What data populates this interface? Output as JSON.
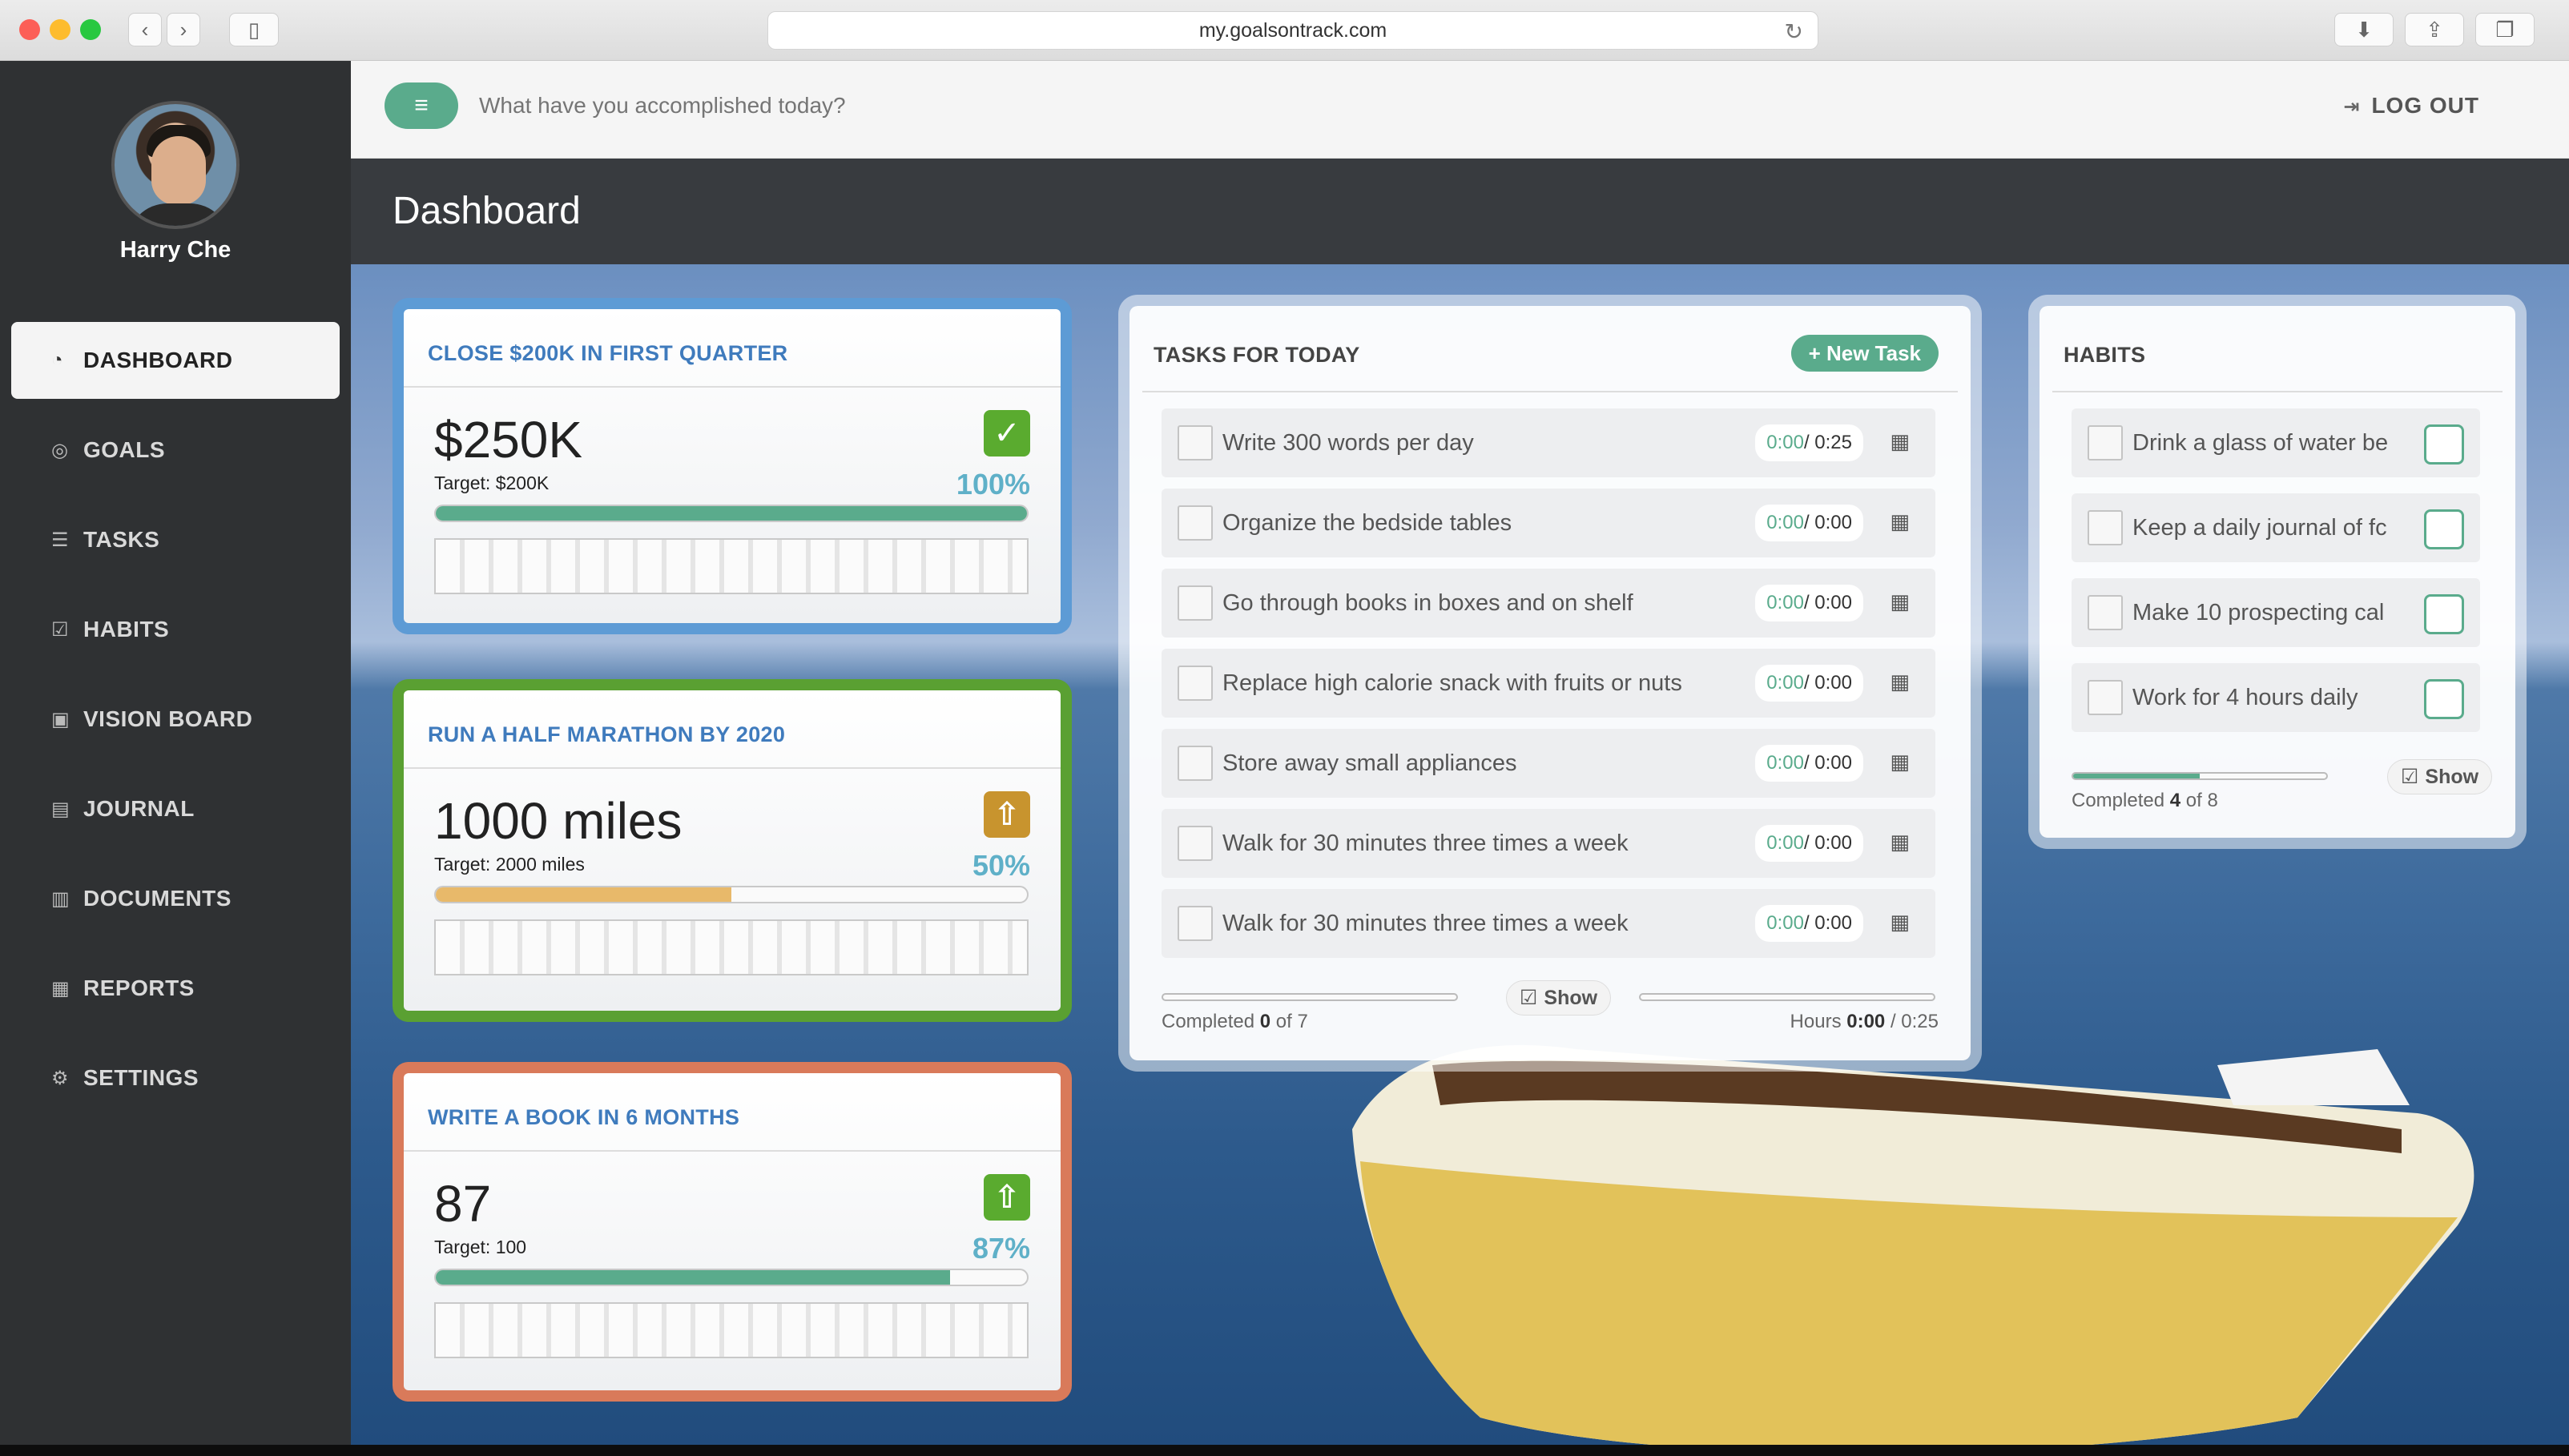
{
  "browser": {
    "url": "my.goalsontrack.com"
  },
  "user": {
    "name": "Harry Che"
  },
  "sidebar": {
    "items": [
      {
        "label": "DASHBOARD",
        "icon": "dashboard-icon",
        "active": true
      },
      {
        "label": "GOALS",
        "icon": "target-icon",
        "active": false
      },
      {
        "label": "TASKS",
        "icon": "list-icon",
        "active": false
      },
      {
        "label": "HABITS",
        "icon": "check-square-icon",
        "active": false
      },
      {
        "label": "VISION BOARD",
        "icon": "picture-icon",
        "active": false
      },
      {
        "label": "JOURNAL",
        "icon": "book-icon",
        "active": false
      },
      {
        "label": "DOCUMENTS",
        "icon": "document-icon",
        "active": false
      },
      {
        "label": "REPORTS",
        "icon": "bar-chart-icon",
        "active": false
      },
      {
        "label": "SETTINGS",
        "icon": "gear-icon",
        "active": false
      }
    ]
  },
  "topbar": {
    "placeholder": "What have you accomplished today?",
    "logout_label": "LOG OUT"
  },
  "page": {
    "title": "Dashboard"
  },
  "goals": [
    {
      "title": "CLOSE $200K IN FIRST QUARTER",
      "value": "$250K",
      "target": "Target: $200K",
      "percent": "100%",
      "progress": 1.0,
      "border_color": "#5d9bd5",
      "bar_color": "#5aab8c",
      "icon": "checkmark-icon",
      "icon_color": "#5aab2f"
    },
    {
      "title": "RUN A HALF MARATHON BY 2020",
      "value": "1000 miles",
      "target": "Target: 2000 miles",
      "percent": "50%",
      "progress": 0.5,
      "border_color": "#5aa032",
      "bar_color": "#e8b96a",
      "icon": "arrow-up-icon",
      "icon_color": "#c8942e"
    },
    {
      "title": "WRITE A BOOK IN 6 MONTHS",
      "value": "87",
      "target": "Target: 100",
      "percent": "87%",
      "progress": 0.87,
      "border_color": "#d97a5a",
      "bar_color": "#5aab8c",
      "icon": "arrow-up-icon",
      "icon_color": "#5aab2f"
    }
  ],
  "tasks": {
    "title": "TASKS FOR TODAY",
    "new_task_label": "+ New Task",
    "items": [
      {
        "label": "Write 300 words per day",
        "done": "0:00",
        "total": " / 0:25"
      },
      {
        "label": "Organize the bedside tables",
        "done": "0:00",
        "total": " / 0:00"
      },
      {
        "label": "Go through books in boxes and on shelf",
        "done": "0:00",
        "total": " / 0:00"
      },
      {
        "label": "Replace high calorie snack with fruits or nuts",
        "done": "0:00",
        "total": " / 0:00"
      },
      {
        "label": "Store away small appliances",
        "done": "0:00",
        "total": " / 0:00"
      },
      {
        "label": "Walk for 30 minutes three times a week",
        "done": "0:00",
        "total": " / 0:00"
      },
      {
        "label": "Walk for 30 minutes three times a week",
        "done": "0:00",
        "total": " / 0:00"
      }
    ],
    "show_label": "Show",
    "completed_prefix": "Completed ",
    "completed_count": "0",
    "completed_suffix": " of 7",
    "hours_prefix": "Hours ",
    "hours_done": "0:00",
    "hours_suffix": " / 0:25"
  },
  "habits": {
    "title": "HABITS",
    "items": [
      {
        "label": "Drink a glass of water be"
      },
      {
        "label": "Keep a daily journal of fc"
      },
      {
        "label": "Make 10 prospecting cal"
      },
      {
        "label": "Work for 4 hours daily"
      }
    ],
    "show_label": "Show",
    "completed_prefix": "Completed ",
    "completed_count": "4",
    "completed_suffix": " of 8",
    "progress": 0.5
  },
  "colors": {
    "accent": "#5aab8c",
    "sidebar": "#2f3133",
    "header": "#383b3f",
    "goal_title": "#3f7bbd"
  }
}
